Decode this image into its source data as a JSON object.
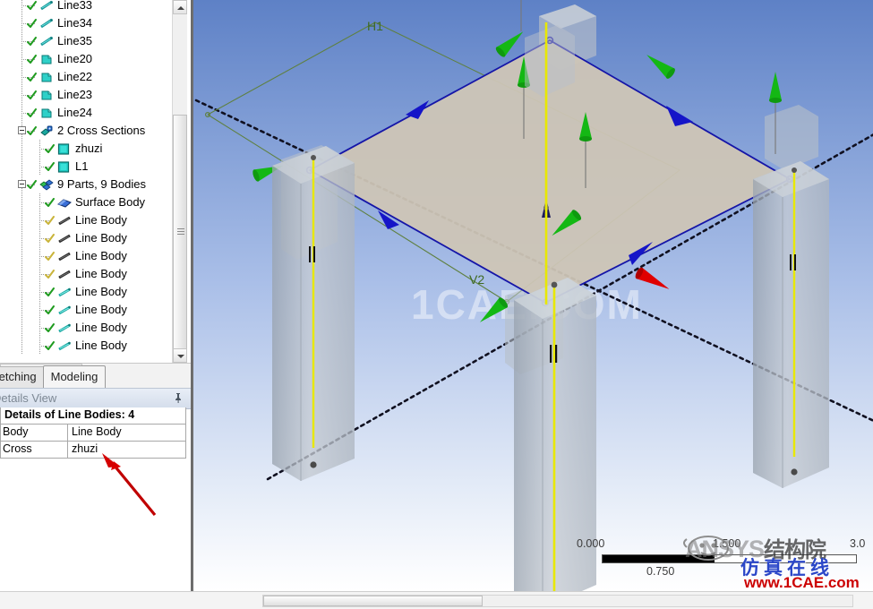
{
  "tree": {
    "items": [
      {
        "label": "Line33",
        "indent": 1,
        "icon": "line-icon",
        "check": "green"
      },
      {
        "label": "Line34",
        "indent": 1,
        "icon": "line-icon",
        "check": "green"
      },
      {
        "label": "Line35",
        "indent": 1,
        "icon": "line-icon",
        "check": "green"
      },
      {
        "label": "Line20",
        "indent": 1,
        "icon": "sketch-icon",
        "check": "green"
      },
      {
        "label": "Line22",
        "indent": 1,
        "icon": "sketch-icon",
        "check": "green"
      },
      {
        "label": "Line23",
        "indent": 1,
        "icon": "sketch-icon",
        "check": "green"
      },
      {
        "label": "Line24",
        "indent": 1,
        "icon": "sketch-icon",
        "check": "green"
      },
      {
        "label": "2 Cross Sections",
        "indent": 1,
        "icon": "cross-section-icon",
        "check": "green",
        "expander": true
      },
      {
        "label": "zhuzi",
        "indent": 2,
        "icon": "section-square-icon",
        "check": "green"
      },
      {
        "label": "L1",
        "indent": 2,
        "icon": "section-square-icon",
        "check": "green"
      },
      {
        "label": "9 Parts, 9 Bodies",
        "indent": 1,
        "icon": "parts-icon",
        "check": "green",
        "expander": true
      },
      {
        "label": "Surface Body",
        "indent": 2,
        "icon": "surface-body-icon",
        "check": "green"
      },
      {
        "label": "Line Body",
        "indent": 2,
        "icon": "line-body-dark-icon",
        "check": "yellow"
      },
      {
        "label": "Line Body",
        "indent": 2,
        "icon": "line-body-dark-icon",
        "check": "yellow"
      },
      {
        "label": "Line Body",
        "indent": 2,
        "icon": "line-body-dark-icon",
        "check": "yellow"
      },
      {
        "label": "Line Body",
        "indent": 2,
        "icon": "line-body-dark-icon",
        "check": "yellow"
      },
      {
        "label": "Line Body",
        "indent": 2,
        "icon": "line-body-teal-icon",
        "check": "green"
      },
      {
        "label": "Line Body",
        "indent": 2,
        "icon": "line-body-teal-icon",
        "check": "green"
      },
      {
        "label": "Line Body",
        "indent": 2,
        "icon": "line-body-teal-icon",
        "check": "green"
      },
      {
        "label": "Line Body",
        "indent": 2,
        "icon": "line-body-teal-icon",
        "check": "green"
      }
    ]
  },
  "tabs": {
    "sketching": "Sketching",
    "modeling": "Modeling"
  },
  "details": {
    "panel_title": "Details View",
    "header": "Details of Line Bodies: 4",
    "rows": [
      {
        "key": "Body",
        "value": "Line Body"
      },
      {
        "key": "Cross Section",
        "value": "zhuzi"
      }
    ]
  },
  "viewport": {
    "dimension_labels": [
      {
        "name": "H1",
        "text": "H1"
      },
      {
        "name": "V2",
        "text": "V2"
      }
    ],
    "watermark_center": "1CAE.COM",
    "scale": {
      "ticks": [
        "0.000",
        "1.500",
        "3.0"
      ],
      "sub_tick": "0.750"
    },
    "colors": {
      "background_top": "#5e81c6",
      "background_bottom": "#ffffff",
      "surface_face": "#cec5b6",
      "surface_edge": "#1b1bb5",
      "line_body_highlight": "#e8e800",
      "column_face": "#b9c0c9",
      "arrow_green": "#14b814",
      "arrow_blue": "#1b1bb5",
      "arrow_red": "#e00000",
      "dimension_green": "#4a7a2a"
    }
  },
  "watermark_br": {
    "ansys_latin": "ANSYS",
    "ansys_cn": "结构院",
    "blue_cn": "仿真在线",
    "url": "www.1CAE.com"
  }
}
